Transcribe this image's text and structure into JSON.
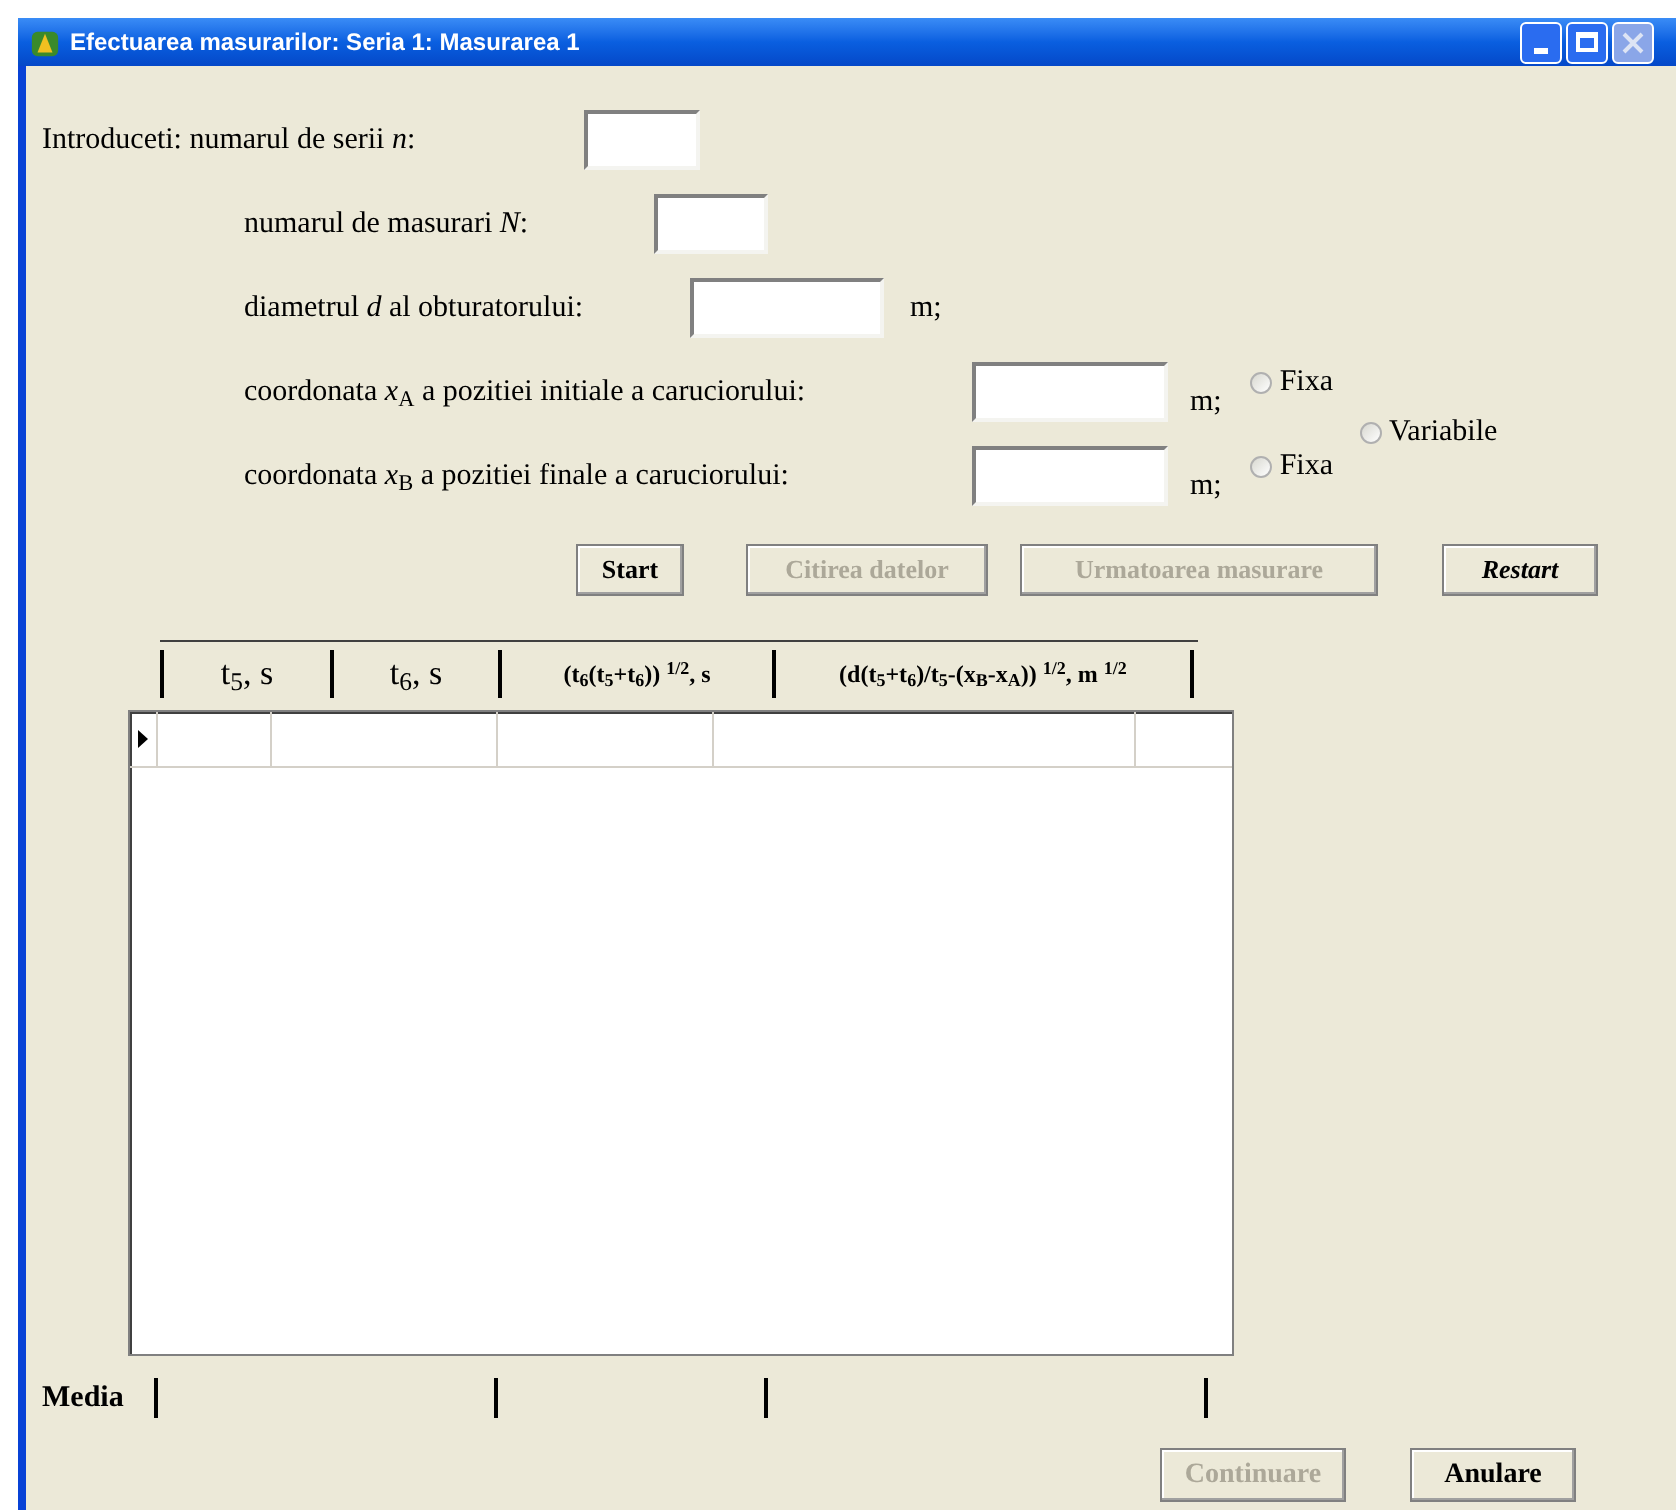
{
  "window": {
    "title": "Efectuarea masurarilor: Seria 1: Masurarea 1"
  },
  "inputs": [
    {
      "label": "Introduceti: numarul de serii *n*:"
    },
    {
      "label": "numarul de masurari  *N*:"
    },
    {
      "label": "diametrul *d* al  obturatorului:",
      "unit": "m;"
    },
    {
      "label": "coordonata *x*$_{A}$ a pozitiei initiale a caruciorului:",
      "unit": "m;",
      "radio": {
        "label": "Fixa",
        "selected": false
      }
    },
    {
      "label": "coordonata *x*$_{B}$ a pozitiei finale a caruciorului:",
      "unit": "m;",
      "radio": {
        "label": "Fixa",
        "selected": false
      }
    }
  ],
  "variable_radio": {
    "label": "Variabile",
    "selected": false
  },
  "buttons": [
    {
      "label": "Start",
      "disabled": false,
      "bold": true,
      "italic": false
    },
    {
      "label": "Citirea datelor",
      "disabled": true,
      "bold": true,
      "italic": false
    },
    {
      "label": "Urmatoarea masurare",
      "disabled": true,
      "bold": true,
      "italic": false
    },
    {
      "label": "Restart",
      "disabled": false,
      "bold": true,
      "italic": true
    }
  ],
  "table": {
    "columns": [
      "t$_{5}$,  s",
      "t$_{6}$,  s",
      "(t$_{6}$(t$_{5}$+t$_{6}$)) $^{1/2}$, s",
      "(d(t$_{5}$+t$_{6}$)/t$_{5}$-(x$_{B}$-x$_{A}$)) $^{1/2}$, m $^{1/2}$"
    ]
  },
  "footer": {
    "label": "Media"
  },
  "dialog_buttons": [
    {
      "label": "Continuare",
      "disabled": true,
      "bold": true
    },
    {
      "label": "Anulare",
      "disabled": false,
      "bold": true
    }
  ]
}
